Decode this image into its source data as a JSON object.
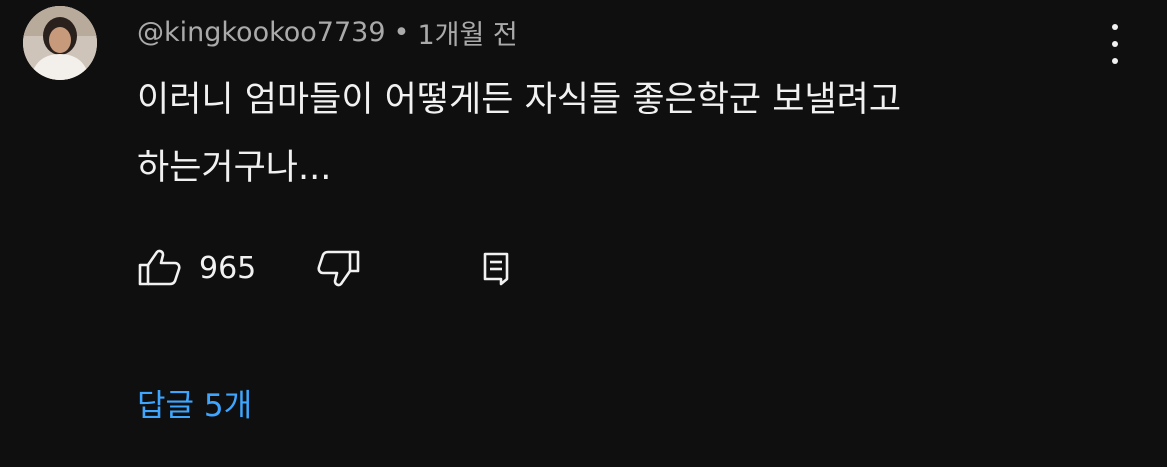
{
  "comment": {
    "author": "@kingkookoo7739",
    "separator": "•",
    "timestamp": "1개월 전",
    "text_lines": [
      "이러니 엄마들이 어떻게든 자식들 좋은학군 보낼려고",
      "하는거구나..."
    ],
    "like_count": "965",
    "replies_label": "답글 5개"
  },
  "icons": {
    "menu": "more-vertical-icon",
    "like": "thumb-up-icon",
    "dislike": "thumb-down-icon",
    "reply": "comment-reply-icon"
  },
  "colors": {
    "background": "#0f0f0f",
    "primary_text": "#f1f1f1",
    "secondary_text": "#aaaaaa",
    "link": "#3ea6ff"
  }
}
